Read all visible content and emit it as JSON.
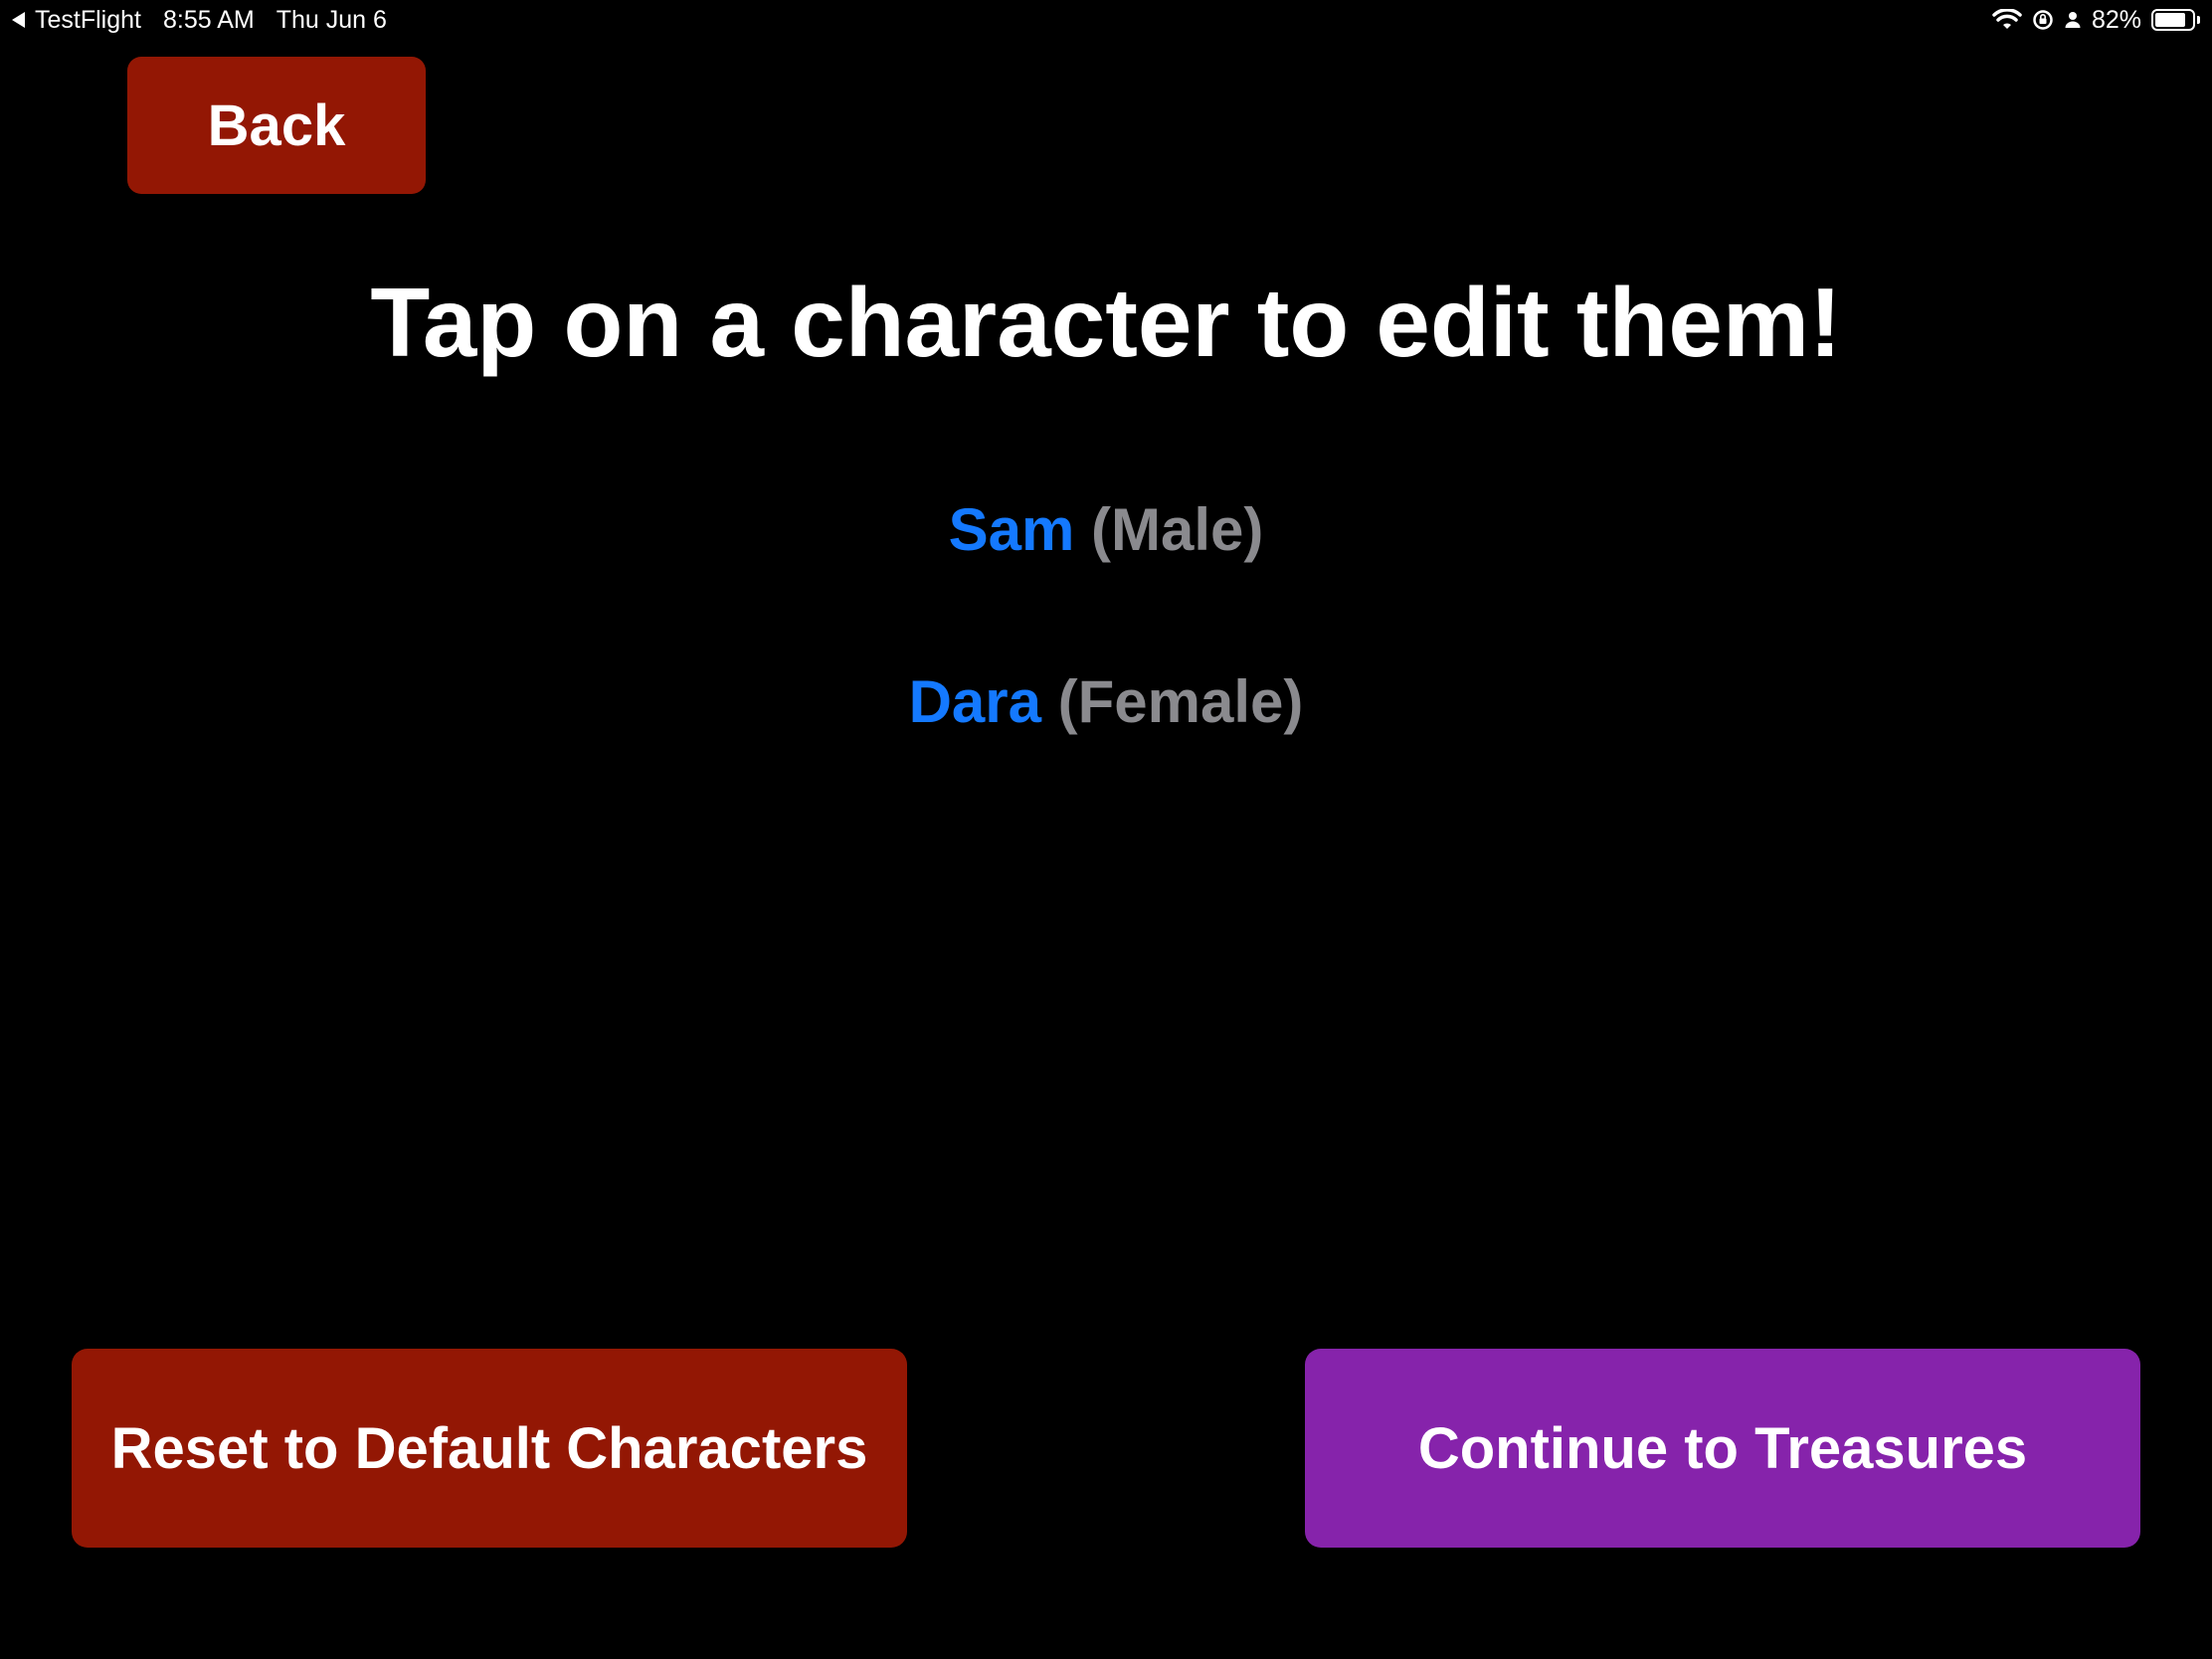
{
  "status_bar": {
    "back_app": "TestFlight",
    "time": "8:55 AM",
    "date": "Thu Jun 6",
    "battery_percent": "82%",
    "battery_level": 0.82,
    "icons": [
      "wifi-icon",
      "screen-rotation-lock-icon",
      "person-icon",
      "battery-icon"
    ]
  },
  "back_button": {
    "label": "Back"
  },
  "title": "Tap on a character to edit them!",
  "characters": [
    {
      "name": "Sam",
      "gender": "(Male)"
    },
    {
      "name": "Dara",
      "gender": "(Female)"
    }
  ],
  "reset_button": {
    "label": "Reset to Default Characters"
  },
  "continue_button": {
    "label": "Continue to Treasures"
  },
  "colors": {
    "background": "#000000",
    "back_button": "#931704",
    "reset_button": "#931704",
    "continue_button": "#8623AB",
    "name_link": "#1479FF",
    "gender_text": "#8A8A8E"
  }
}
